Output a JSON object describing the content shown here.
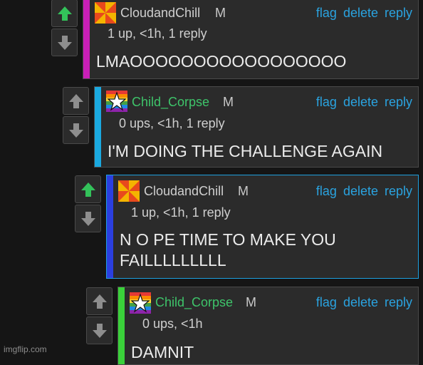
{
  "colors": {
    "background": "#151515",
    "card": "#2b2b2b",
    "link": "#2aa3e0",
    "upvoted": "#33c25a",
    "neutral_arrow": "#8e8e8e",
    "user_cloud": "#cfcfcf",
    "user_child": "#3ec46a"
  },
  "comments": [
    {
      "username": "CloudandChill",
      "gender": "M",
      "meta": "1 up, <1h, 1 reply",
      "text_lines": [
        "LMAOOOOOOOOOOOOOOOOO"
      ],
      "stripe_color": "#c91fb7",
      "avatar_icon": "pinwheel-avatar-icon",
      "upvoted": true,
      "actions": {
        "flag": "flag",
        "delete": "delete",
        "reply": "reply"
      }
    },
    {
      "username": "Child_Corpse",
      "gender": "M",
      "meta": "0 ups, <1h, 1 reply",
      "text_lines": [
        "I'M DOING THE CHALLENGE AGAIN"
      ],
      "stripe_color": "#1aa9e0",
      "avatar_icon": "rainbow-star-avatar-icon",
      "upvoted": false,
      "actions": {
        "flag": "flag",
        "delete": "delete",
        "reply": "reply"
      }
    },
    {
      "username": "CloudandChill",
      "gender": "M",
      "meta": "1 up, <1h, 1 reply",
      "text_lines": [
        "N O PE TIME TO MAKE YOU",
        "FAILLLLLLLLL"
      ],
      "stripe_color": "#2b3fe0",
      "avatar_icon": "pinwheel-avatar-icon",
      "upvoted": true,
      "actions": {
        "flag": "flag",
        "delete": "delete",
        "reply": "reply"
      }
    },
    {
      "username": "Child_Corpse",
      "gender": "M",
      "meta": "0 ups, <1h",
      "text_lines": [
        "DAMNIT"
      ],
      "stripe_color": "#3ad13a",
      "avatar_icon": "rainbow-star-avatar-icon",
      "upvoted": false,
      "actions": {
        "flag": "flag",
        "delete": "delete",
        "reply": "reply"
      }
    }
  ],
  "watermark": "imgflip.com"
}
